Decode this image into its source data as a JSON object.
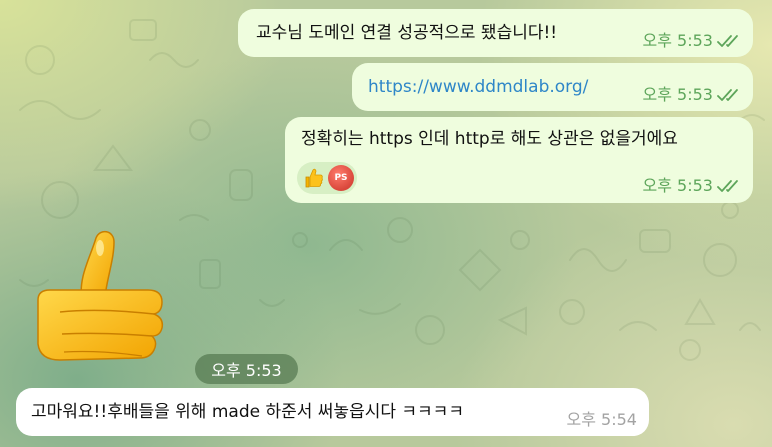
{
  "messages": [
    {
      "id": "b1",
      "direction": "outgoing",
      "text": "교수님 도메인 연결 성공적으로 됐습니다!!",
      "time": "오후 5:53",
      "status": "read"
    },
    {
      "id": "b2",
      "direction": "outgoing",
      "text": "https://www.ddmdlab.org/",
      "is_link": true,
      "time": "오후 5:53",
      "status": "read"
    },
    {
      "id": "b3",
      "direction": "outgoing",
      "text": "정확히는 https 인데 http로 해도 상관은 없을거에요",
      "time": "오후 5:53",
      "status": "read",
      "reaction": {
        "emoji": "thumbs-up",
        "reactor_initials": "PS"
      }
    },
    {
      "id": "sticker",
      "direction": "incoming",
      "type": "sticker",
      "sticker": "thumbs-up",
      "time": "오후 5:53"
    },
    {
      "id": "b4",
      "direction": "incoming",
      "text": "고마워요!!후배들을 위해 made 하준서 써놓읍시다 ㅋㅋㅋㅋ",
      "time": "오후 5:54"
    }
  ],
  "colors": {
    "outgoing_bubble": "#effdde",
    "incoming_bubble": "#ffffff",
    "outgoing_meta": "#5da55a",
    "incoming_meta": "#a3a3a3",
    "link": "#2e86c8",
    "reaction_pill": "#d7efc4"
  }
}
